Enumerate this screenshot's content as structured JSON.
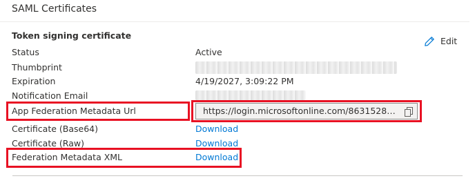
{
  "section": {
    "title": "SAML Certificates"
  },
  "token_signing": {
    "heading": "Token signing certificate",
    "edit_label": "Edit",
    "rows": {
      "status": {
        "label": "Status",
        "value": "Active"
      },
      "thumbprint": {
        "label": "Thumbprint"
      },
      "expiration": {
        "label": "Expiration",
        "value": "4/19/2027, 3:09:22 PM"
      },
      "notification_email": {
        "label": "Notification Email"
      },
      "app_federation_metadata_url": {
        "label": "App Federation Metadata Url",
        "value": "https://login.microsoftonline.com/86315286-b8f ..."
      },
      "certificate_base64": {
        "label": "Certificate (Base64)",
        "action": "Download"
      },
      "certificate_raw": {
        "label": "Certificate (Raw)",
        "action": "Download"
      },
      "federation_metadata_xml": {
        "label": "Federation Metadata XML",
        "action": "Download"
      }
    }
  },
  "colors": {
    "link": "#0078d4",
    "highlight": "#e81123",
    "text": "#323130"
  },
  "icons": {
    "edit": "pencil-icon",
    "copy": "copy-icon"
  }
}
